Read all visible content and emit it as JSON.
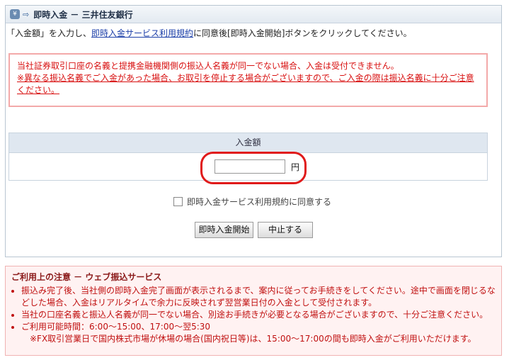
{
  "header": {
    "icon_text": "¥",
    "arrow": "⇨",
    "title": "即時入金 － 三井住友銀行"
  },
  "intro": {
    "prefix": "「入金額」を入力し、",
    "link": "即時入金サービス利用規約",
    "suffix": "に同意後[即時入金開始]ボタンをクリックしてください。"
  },
  "alert": {
    "line1": "当社証券取引口座の名義と提携金融機関側の振込人名義が同一でない場合、入金は受付できません。",
    "line2": "※異なる振込名義でご入金があった場合、お取引を停止する場合がございますので、ご入金の際は振込名義に十分ご注意ください。"
  },
  "amount": {
    "header": "入金額",
    "unit": "円",
    "value": ""
  },
  "agree": {
    "label": "即時入金サービス利用規約に同意する"
  },
  "buttons": {
    "start": "即時入金開始",
    "stop": "中止する"
  },
  "notes": {
    "title": "ご利用上の注意 － ウェブ振込サービス",
    "items": [
      "振込み完了後、当社側の即時入金完了画面が表示されるまで、案内に従ってお手続きをしてください。途中で画面を閉じるなどした場合、入金はリアルタイムで余力に反映されず翌営業日付の入金として受付されます。",
      "当社の口座名義と振込人名義が同一でない場合、別途お手続きが必要となる場合がございますので、十分ご注意ください。",
      "ご利用可能時間：6:00～15:00、17:00～翌5:30"
    ],
    "sub": "※FX取引営業日で国内株式市場が休場の場合(国内祝日等)は、15:00～17:00の間も即時入金がご利用いただけます。"
  }
}
